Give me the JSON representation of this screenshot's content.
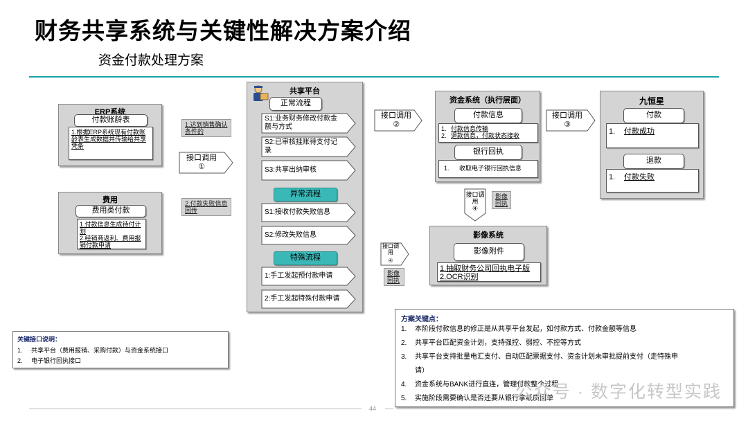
{
  "title": "财务共享系统与关键性解决方案介绍",
  "subtitle": "资金付款处理方案",
  "erp": {
    "title": "ERP系统",
    "pill": "付款账龄表",
    "content": "1.根据ERP系统现有付款账龄表生成数据并传输给共享凭条"
  },
  "expense": {
    "title": "费用",
    "pill": "费用类付款",
    "line1": "1.付款信息生成待付计划",
    "line2": "2.经销商返利、费用报销付款申请"
  },
  "tag_condition": "1.达到销售确认条件的",
  "tag_fail": "2.付款失败信息回传",
  "arrow1_label": "接口调用",
  "arrow1_num": "①",
  "share": {
    "title": "共享平台",
    "normal_label": "正常流程",
    "normal_steps": [
      "S1:业务财务修改付款金额与方式",
      "S2:已审核挂账待支付记录",
      "S3:共享出纳审核"
    ],
    "abnormal_label": "异常流程",
    "abnormal_steps": [
      "S1:接收付款失败信息",
      "S2:修改失败信息"
    ],
    "special_label": "特殊流程",
    "special_steps": [
      "1:手工发起预付款申请",
      "2:手工发起特殊付款申请"
    ]
  },
  "arrow2_label": "接口调用",
  "arrow2_num": "②",
  "fund": {
    "title": "资金系统（执行层面）",
    "pay_pill": "付款信息",
    "pay_line1": "付款信息传输",
    "pay_line2": "退款信息，付款状态接收",
    "receipt_pill": "银行回执",
    "receipt_line1": "收取电子银行回执信息"
  },
  "arrow3_label": "接口调用",
  "arrow3_num": "③",
  "jhx": {
    "title": "九恒星",
    "pay_pill": "付款",
    "pay_line": "付款成功",
    "refund_pill": "退款",
    "refund_line": "付款失败"
  },
  "arrow4_label": "接口调用",
  "arrow4_num": "④",
  "tag_image1": "影像回执",
  "image": {
    "title": "影像系统",
    "pill": "影像附件",
    "line1": "1.抽取财务公司回执电子版",
    "line2": "2.OCR识别"
  },
  "arrow5_label": "接口调用",
  "arrow5_num": "④",
  "tag_image2": "影像回执",
  "key_interfaces": {
    "title": "关键接口说明：",
    "items": [
      "共享平台（费用报销、采购付款）与资金系统接口",
      "电子银行回执接口"
    ],
    "nums": [
      "1.",
      "2."
    ]
  },
  "key_points": {
    "title": "方案关键点：",
    "nums": [
      "1.",
      "2.",
      "3.",
      "4.",
      "5."
    ],
    "items": [
      "本阶段付款信息的修正是从共享平台发起，如付款方式、付款金额等信息",
      "共享平台匹配资金计划，支持强控、弱控、不控等方式",
      "共享平台支持批量电汇支付、自动匹配票据支付、资金计划未审批提前支付（走特殊申",
      "请）",
      "资金系统与BANK进行直连，管理付款整个过程",
      "实施阶段需要确认是否还要从银行拿纸质回单"
    ]
  },
  "watermark": "公众号 · 数字化转型实践",
  "page_number": "44",
  "colors": {
    "accent_teal": "#1aa3a3",
    "panel_gray": "#d4d4d4",
    "teal_pill": "#3ab8b8"
  }
}
